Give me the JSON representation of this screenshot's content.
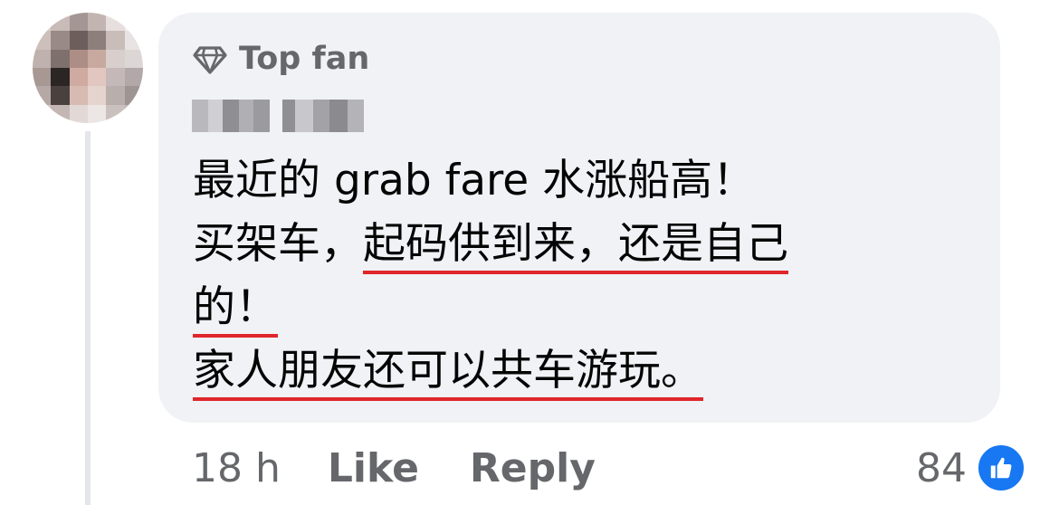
{
  "badge": {
    "label": "Top fan",
    "icon": "diamond-icon"
  },
  "comment": {
    "lines": [
      [
        "最近的 grab fare 水涨船高！"
      ],
      [
        "买架车，",
        "起码供到来，还是自己"
      ],
      [
        "的！"
      ],
      [
        "家人朋友还可以共车游玩。"
      ]
    ]
  },
  "actions": {
    "timestamp": "18 h",
    "like_label": "Like",
    "reply_label": "Reply"
  },
  "reactions": {
    "count": "84",
    "icon": "thumbs-up-icon",
    "color": "#1877f2"
  },
  "colors": {
    "bubble": "#f0f2f5",
    "text": "#050505",
    "secondary": "#65676b",
    "underline": "#e0262b"
  }
}
